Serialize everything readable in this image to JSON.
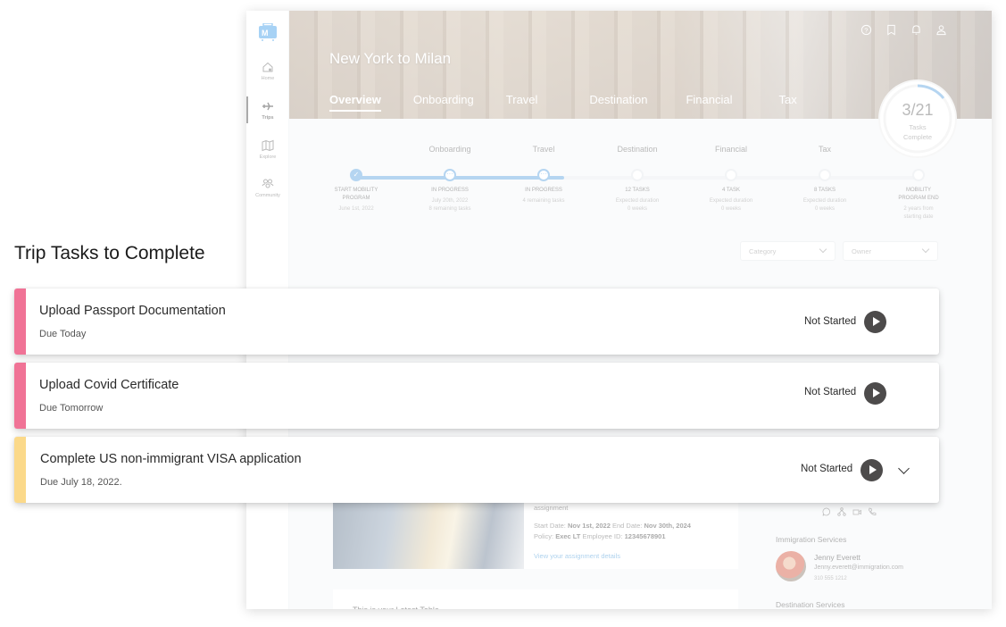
{
  "app": {
    "brand_letter": "M",
    "sidebar": {
      "items": [
        {
          "label": "Home",
          "icon": "home-icon",
          "active": false
        },
        {
          "label": "Trips",
          "icon": "plane-icon",
          "active": true
        },
        {
          "label": "Explore",
          "icon": "map-icon",
          "active": false
        },
        {
          "label": "Community",
          "icon": "community-icon",
          "active": false
        }
      ]
    },
    "header": {
      "title": "New York to Milan",
      "tabs": [
        {
          "label": "Overview",
          "active": true
        },
        {
          "label": "Onboarding",
          "active": false
        },
        {
          "label": "Travel",
          "active": false
        },
        {
          "label": "Destination",
          "active": false
        },
        {
          "label": "Financial",
          "active": false
        },
        {
          "label": "Tax",
          "active": false
        }
      ],
      "icons": [
        "help-icon",
        "bookmark-icon",
        "notification-bell-icon",
        "user-profile-icon"
      ]
    },
    "task_progress": {
      "completed": 3,
      "total": 21,
      "count_text": "3/21",
      "label_line1": "Tasks",
      "label_line2": "Complete",
      "accent_color": "#5ba3e0"
    },
    "timeline": {
      "progress_fraction": 0.37,
      "steps": [
        {
          "stage": "",
          "state": "done",
          "status": "START MOBILITY PROGRAM",
          "sub1": "June 1st, 2022",
          "sub2": ""
        },
        {
          "stage": "Onboarding",
          "state": "progress",
          "status": "IN PROGRESS",
          "sub1": "July 20th, 2022",
          "sub2": "8 remaining tasks"
        },
        {
          "stage": "Travel",
          "state": "progress",
          "status": "IN PROGRESS",
          "sub1": "4 remaining tasks",
          "sub2": ""
        },
        {
          "stage": "Destination",
          "state": "pending",
          "status": "12 TASKS",
          "sub1": "Expected duration",
          "sub2": "0 weeks"
        },
        {
          "stage": "Financial",
          "state": "pending",
          "status": "4 TASK",
          "sub1": "Expected duration",
          "sub2": "0 weeks"
        },
        {
          "stage": "Tax",
          "state": "pending",
          "status": "8 TASKS",
          "sub1": "Expected duration",
          "sub2": "0 weeks"
        },
        {
          "stage": "",
          "state": "pending",
          "status": "MOBILITY PROGRAM END",
          "sub1": "2 years from",
          "sub2": "starting date"
        }
      ]
    },
    "filters": [
      {
        "placeholder": "Category"
      },
      {
        "placeholder": "Owner"
      }
    ],
    "assignment": {
      "text_tail": "assignment",
      "start_label": "Start Date:",
      "start_value": "Nov 1st, 2022",
      "end_label": "End Date:",
      "end_value": "Nov 30th, 2024",
      "policy_label": "Policy:",
      "policy_value": "Exec LT",
      "employee_label": "Employee ID:",
      "employee_value": "12345678901",
      "link": "View your assignment details"
    },
    "bottom_card_partial_text": "This is your Latest Table",
    "contacts": {
      "action_icons": [
        "chat-icon",
        "org-chart-icon",
        "video-call-icon",
        "phone-icon"
      ],
      "immigration_title": "Immigration Services",
      "immigration_contact": {
        "name": "Jenny Everett",
        "email": "Jenny.everett@immigration.com",
        "phone": "310 555 1212"
      },
      "destination_title": "Destination Services"
    }
  },
  "overlay": {
    "title": "Trip Tasks to Complete",
    "tasks": [
      {
        "title": "Upload Passport Documentation",
        "due": "Due Today",
        "status": "Not Started",
        "priority_color": "#f07396",
        "expandable": false
      },
      {
        "title": "Upload Covid Certificate",
        "due": "Due Tomorrow",
        "status": "Not Started",
        "priority_color": "#f07396",
        "expandable": false
      },
      {
        "title": "Complete US non-immigrant VISA application",
        "due": "Due July 18, 2022.",
        "status": "Not Started",
        "priority_color": "#fbd98a",
        "expandable": true
      }
    ]
  }
}
